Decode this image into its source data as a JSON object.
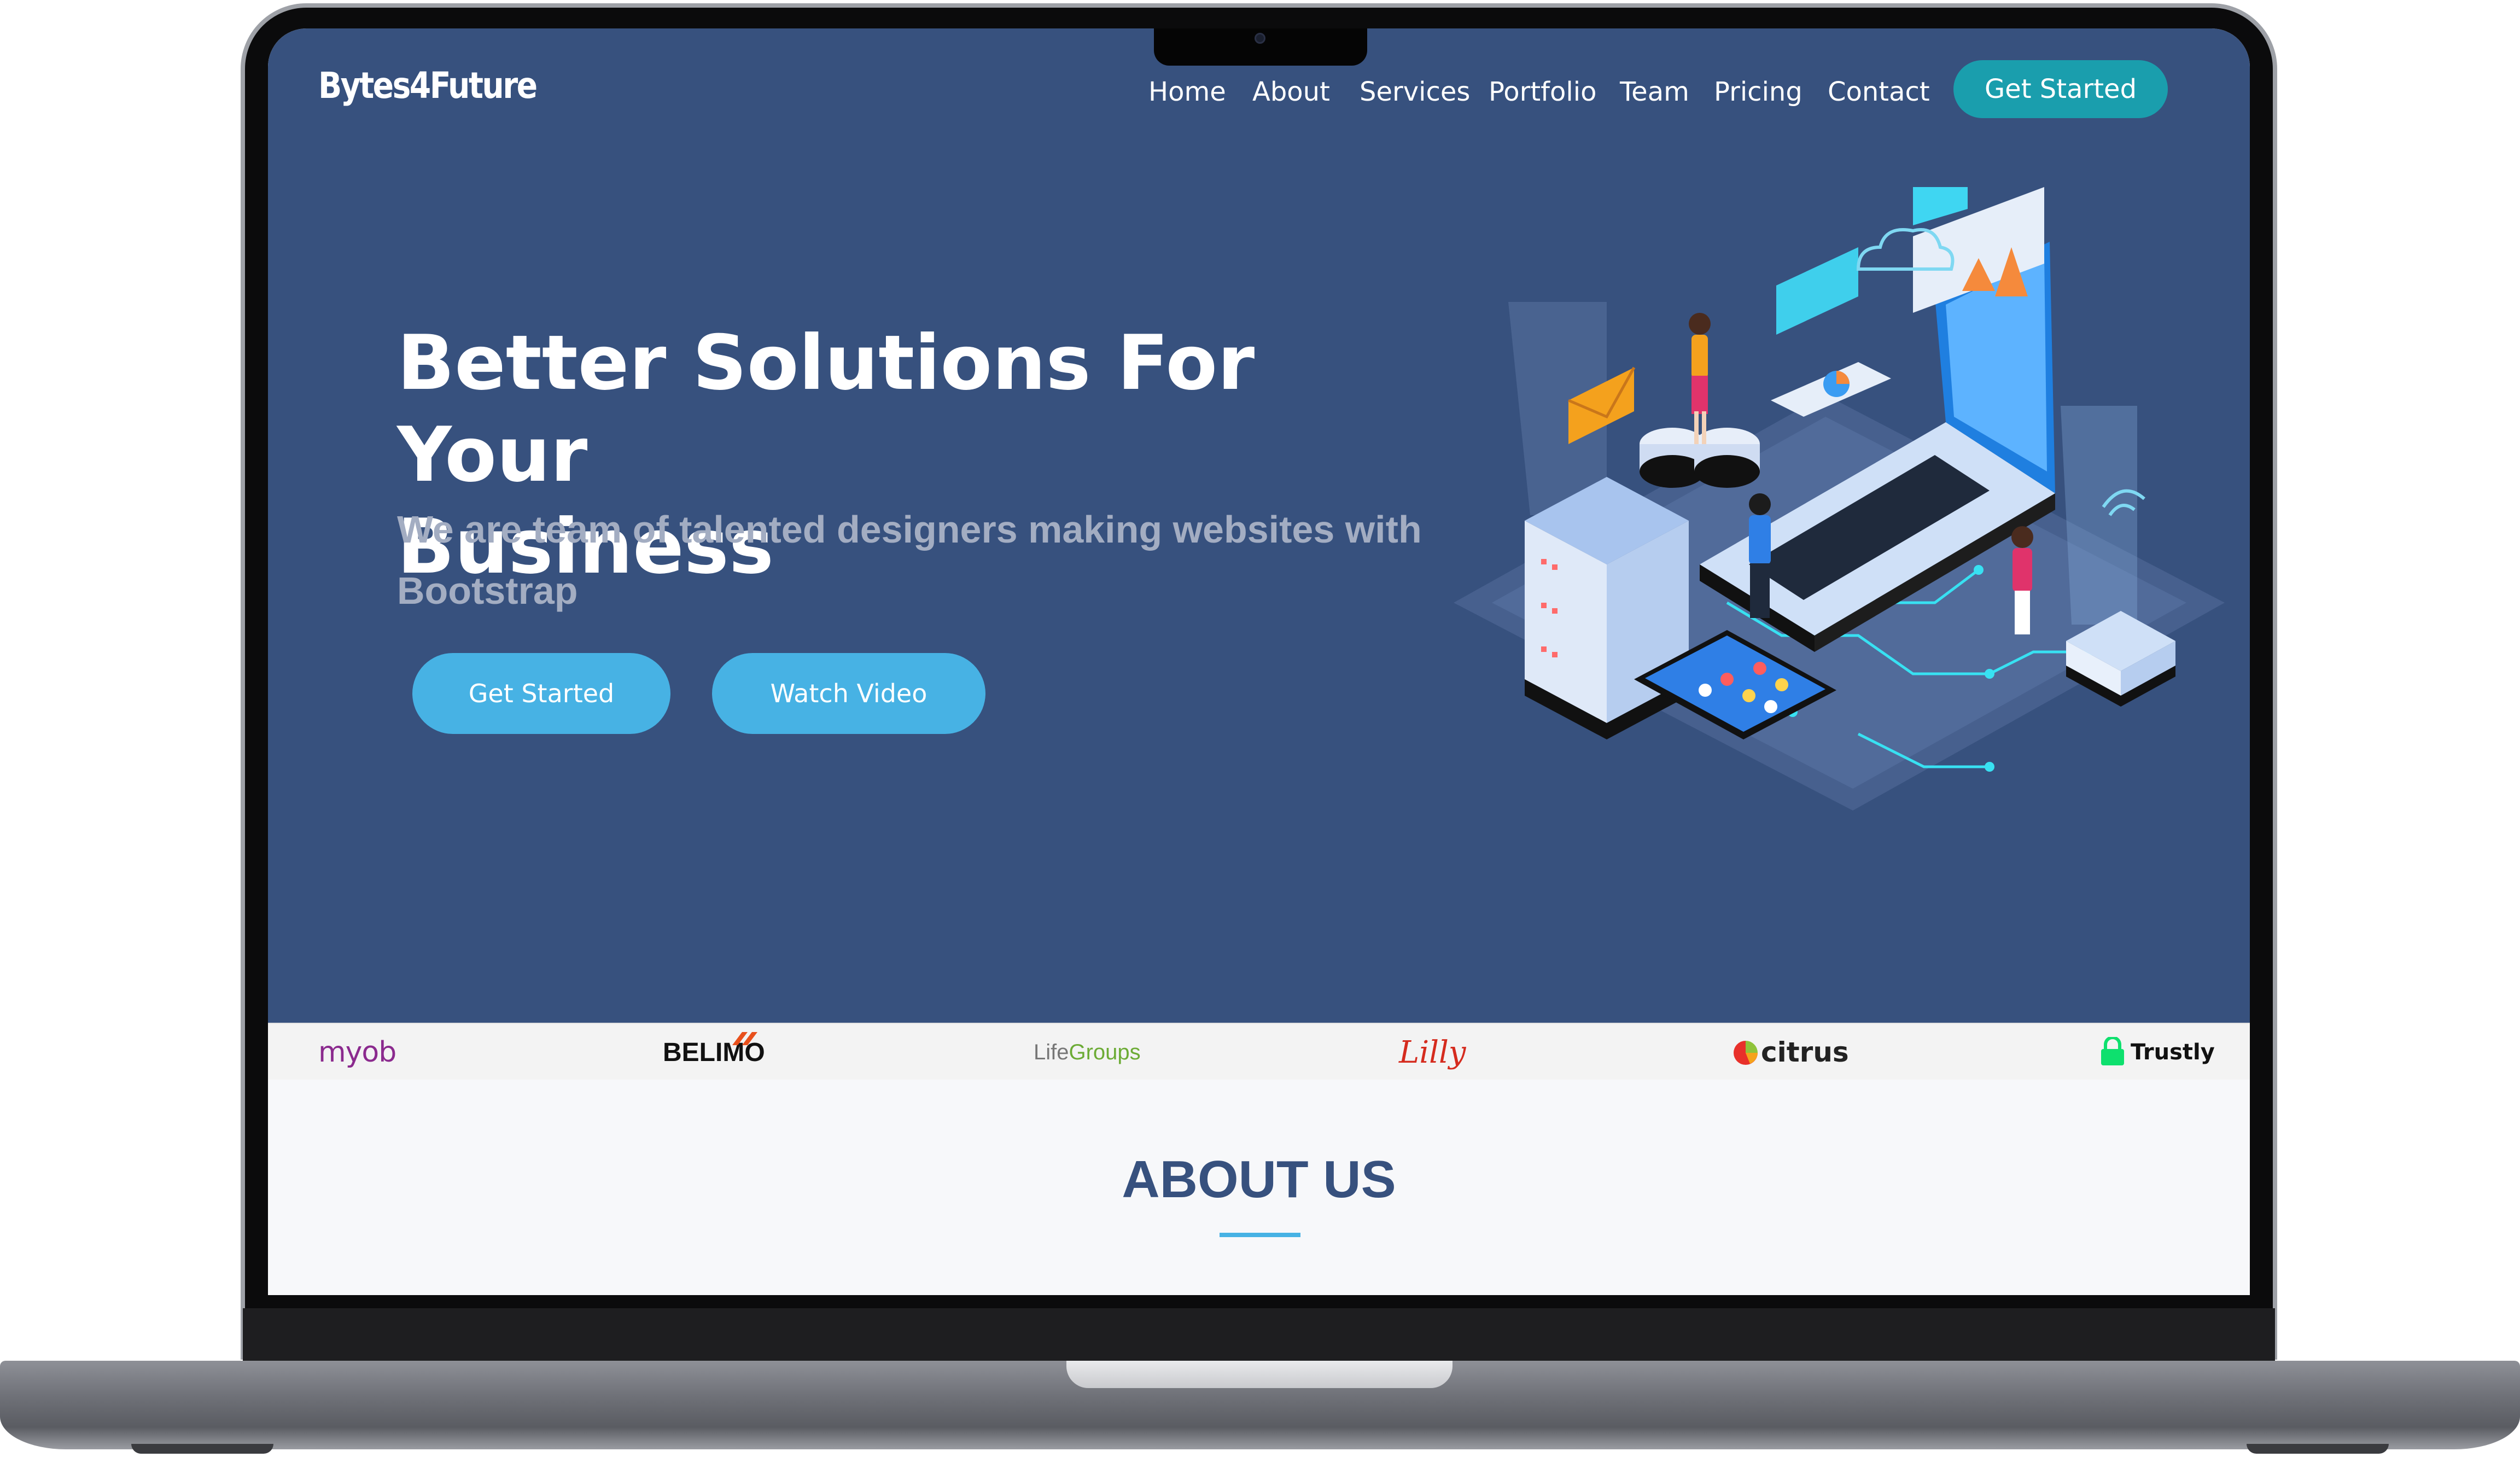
{
  "brand": "Bytes4Future",
  "nav": {
    "items": [
      "Home",
      "About",
      "Services",
      "Portfolio",
      "Team",
      "Pricing",
      "Contact"
    ],
    "cta": "Get Started"
  },
  "hero": {
    "title_line1": "Better Solutions For Your",
    "title_line2": "Business",
    "subtitle": "We are team of talented designers making websites with Bootstrap",
    "btn_primary": "Get Started",
    "btn_secondary": "Watch Video"
  },
  "clients": {
    "myob": "myob",
    "belimo": "BELIMO",
    "lifegroups_a": "Life",
    "lifegroups_b": "Groups",
    "lilly": "Lilly",
    "citrus": "citrus",
    "trustly": "Trustly"
  },
  "about": {
    "title": "ABOUT US"
  },
  "colors": {
    "hero_bg": "#37517e",
    "accent": "#47b2e4",
    "nav_cta": "#1a9ead",
    "about_title": "#37517e"
  }
}
